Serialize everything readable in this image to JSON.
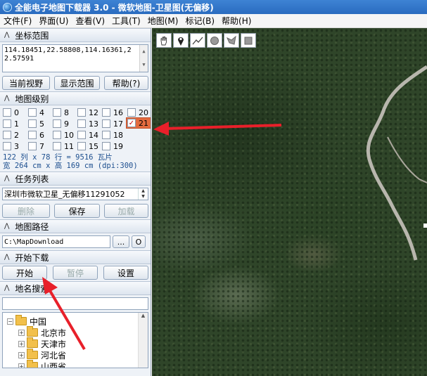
{
  "window": {
    "title": "全能电子地图下载器 3.0 - 微软地图-卫星图(无偏移)"
  },
  "menu": [
    "文件(F)",
    "界面(U)",
    "查看(V)",
    "工具(T)",
    "地图(M)",
    "标记(B)",
    "帮助(H)"
  ],
  "coord_section": {
    "header": "坐标范围",
    "value": "114.18451,22.58808,114.16361,22.57591",
    "buttons": [
      "当前视野",
      "显示范围",
      "帮助(?)"
    ]
  },
  "level_section": {
    "header": "地图级别",
    "levels": [
      "0",
      "1",
      "2",
      "3",
      "4",
      "5",
      "6",
      "7",
      "8",
      "9",
      "10",
      "11",
      "12",
      "13",
      "14",
      "15",
      "16",
      "17",
      "18",
      "19",
      "20",
      "21"
    ],
    "checked": "21",
    "info_line1": "122 列 x 78 行 = 9516 瓦片",
    "info_line2": "宽 264 cm x 高 169 cm (dpi:300)"
  },
  "task_section": {
    "header": "任务列表",
    "selected": "深圳市微软卫星_无偏移11291052",
    "buttons": [
      "删除",
      "保存",
      "加载"
    ]
  },
  "path_section": {
    "header": "地图路径",
    "path": "C:\\MapDownload",
    "browse": "...",
    "open": "O"
  },
  "download_section": {
    "header": "开始下载",
    "buttons": [
      "开始",
      "暂停",
      "设置"
    ]
  },
  "place_section": {
    "header": "地名搜索",
    "tree": [
      "中国",
      "北京市",
      "天津市",
      "河北省",
      "山西省"
    ]
  },
  "map_tools": [
    "hand-tool-icon",
    "marker-tool-icon",
    "polyline-tool-icon",
    "circle-tool-icon",
    "polygon-tool-icon",
    "rectangle-tool-icon"
  ],
  "colors": {
    "title_bar": "#2a6bbf",
    "checked_level": "#e36b3f",
    "arrow": "#e8202a",
    "info_text": "#1d4f8f"
  }
}
